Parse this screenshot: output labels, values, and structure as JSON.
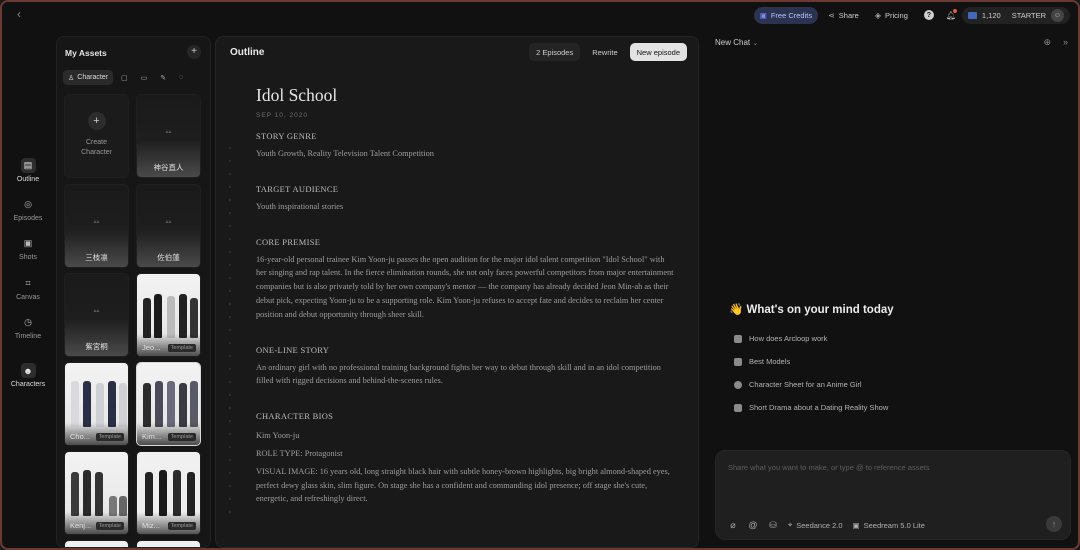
{
  "topbar": {
    "credits_label": "Free Credits",
    "share_label": "Share",
    "pricing_label": "Pricing",
    "credits_count": "1,120",
    "plan_label": "STARTER"
  },
  "rail": {
    "items": [
      {
        "label": "Outline",
        "icon": "document-icon"
      },
      {
        "label": "Episodes",
        "icon": "film-reel-icon"
      },
      {
        "label": "Shots",
        "icon": "clapper-icon"
      },
      {
        "label": "Canvas",
        "icon": "crop-icon"
      },
      {
        "label": "Timeline",
        "icon": "clock-icon"
      },
      {
        "label": "Characters",
        "icon": "people-icon"
      }
    ]
  },
  "assets": {
    "title": "My Assets",
    "tab_character": "Character",
    "create_label_1": "Create",
    "create_label_2": "Character",
    "cards": [
      {
        "name": "神谷直人",
        "template": false
      },
      {
        "name": "三枝凛",
        "template": false
      },
      {
        "name": "佐伯蓮",
        "template": false
      },
      {
        "name": "紫宮桐",
        "template": false
      },
      {
        "name": "Jeo...",
        "template": true
      },
      {
        "name": "Cho...",
        "template": true
      },
      {
        "name": "Kim...",
        "template": true
      },
      {
        "name": "Kenj...",
        "template": true
      },
      {
        "name": "Miz...",
        "template": true
      }
    ],
    "template_tag": "Template"
  },
  "outline": {
    "title": "Outline",
    "episodes_btn": "2 Episodes",
    "rewrite_btn": "Rewrite",
    "new_episode_btn": "New episode",
    "doc_title": "Idol School",
    "doc_date": "SEP 10, 2020",
    "sections": {
      "genre_h": "STORY GENRE",
      "genre_p": "Youth Growth, Reality Television Talent Competition",
      "audience_h": "TARGET AUDIENCE",
      "audience_p": "Youth inspirational stories",
      "premise_h": "CORE PREMISE",
      "premise_p": "16-year-old personal trainee Kim Yoon-ju passes the open audition for the major idol talent competition \"Idol School\" with her singing and rap talent. In the fierce elimination rounds, she not only faces powerful competitors from major entertainment companies but is also privately told by her own company's mentor — the company has already decided Jeon Min-ah as their debut pick, expecting Yoon-ju to be a supporting role. Kim Yoon-ju refuses to accept fate and decides to reclaim her center position and debut opportunity through sheer skill.",
      "oneline_h": "ONE-LINE STORY",
      "oneline_p": "An ordinary girl with no professional training background fights her way to debut through skill and in an idol competition filled with rigged decisions and behind-the-scenes rules.",
      "bios_h": "CHARACTER BIOS",
      "bios_name": "Kim Yoon-ju",
      "bios_role": "ROLE TYPE: Protagonist",
      "bios_visual": "VISUAL IMAGE: 16 years old, long straight black hair with subtle honey-brown highlights, big bright almond-shaped eyes, perfect dewy glass skin, slim figure. On stage she has a confident and commanding idol presence; off stage she's cute, energetic, and refreshingly direct."
    }
  },
  "chat": {
    "title": "New Chat",
    "greeting": "👋 What's on your mind today",
    "suggestions": [
      "How does Arcloop work",
      "Best Models",
      "Character Sheet for an Anime Girl",
      "Short Drama about a Dating Reality Show"
    ],
    "composer_placeholder": "Share what you want to make, or type @ to reference assets",
    "model_1": "Seedance 2.0",
    "model_2": "Seedream 5.0 Lite"
  },
  "colors": {
    "frame_border": "#6a3a32",
    "credits_bg": "#2c3350",
    "primary_button": "#e3e3e3"
  }
}
